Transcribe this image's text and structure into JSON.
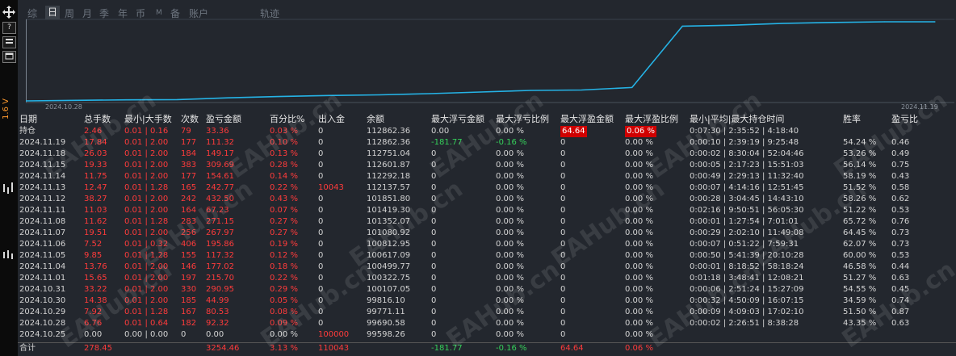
{
  "tabs": [
    "综",
    "日",
    "周",
    "月",
    "季",
    "年",
    "币",
    "M",
    "备",
    "账户",
    "轨迹"
  ],
  "active_tab": "日",
  "left_toolbar": {
    "icons": [
      "move-icon",
      "help-icon",
      "layout-icon",
      "window-icon"
    ],
    "help_glyph": "?",
    "vertical_text": "1.6 V"
  },
  "chart_data": {
    "type": "line",
    "x_start_label": "2024.10.28",
    "x_end_label": "2024.11.19",
    "color": "#25b3e6",
    "x": [
      "2024.10.25",
      "2024.10.28",
      "2024.10.29",
      "2024.10.30",
      "2024.10.31",
      "2024.11.01",
      "2024.11.04",
      "2024.11.05",
      "2024.11.06",
      "2024.11.07",
      "2024.11.08",
      "2024.11.11",
      "2024.11.12",
      "2024.11.13",
      "2024.11.14",
      "2024.11.15",
      "2024.11.18",
      "2024.11.19",
      "持仓"
    ],
    "y": [
      99598.26,
      99690.58,
      99771.11,
      99816.1,
      100107.05,
      100322.75,
      100499.77,
      100617.09,
      100812.95,
      101080.92,
      101352.07,
      101419.3,
      101851.8,
      112137.57,
      112292.18,
      112601.87,
      112751.04,
      112862.36,
      112862.36
    ]
  },
  "table": {
    "headers": [
      "日期",
      "总手数",
      "最小|大手数",
      "次数",
      "盈亏金额",
      "百分比%",
      "出入金",
      "余额",
      "最大浮亏金额",
      "最大浮亏比例",
      "最大浮盈金额",
      "最大浮盈比例",
      "最小|平均|最大持仓时间",
      "胜率",
      "盈亏比"
    ],
    "rows": [
      [
        "持仓",
        "2.46",
        "0.01 | 0.16",
        "79",
        "33.36",
        "0.03 %",
        "0",
        "112862.36",
        "0.00",
        "0.00 %",
        "64.64",
        "0.06 %",
        "0:07:30 | 2:35:52 | 4:18:40",
        "",
        ""
      ],
      [
        "2024.11.19",
        "17.84",
        "0.01 | 2.00",
        "177",
        "111.32",
        "0.10 %",
        "0",
        "112862.36",
        "-181.77",
        "-0.16 %",
        "0",
        "0.00 %",
        "0:00:10 | 2:39:19 | 9:25:48",
        "54.24 %",
        "0.46"
      ],
      [
        "2024.11.18",
        "26.03",
        "0.01 | 2.00",
        "184",
        "149.17",
        "0.13 %",
        "0",
        "112751.04",
        "0",
        "0.00 %",
        "0",
        "0.00 %",
        "0:00:02 | 8:30:04 | 52:04:46",
        "53.26 %",
        "0.49"
      ],
      [
        "2024.11.15",
        "19.33",
        "0.01 | 2.00",
        "383",
        "309.69",
        "0.28 %",
        "0",
        "112601.87",
        "0",
        "0.00 %",
        "0",
        "0.00 %",
        "0:00:05 | 2:17:23 | 15:51:03",
        "56.14 %",
        "0.75"
      ],
      [
        "2024.11.14",
        "11.75",
        "0.01 | 2.00",
        "177",
        "154.61",
        "0.14 %",
        "0",
        "112292.18",
        "0",
        "0.00 %",
        "0",
        "0.00 %",
        "0:00:49 | 2:29:13 | 11:32:40",
        "58.19 %",
        "0.43"
      ],
      [
        "2024.11.13",
        "12.47",
        "0.01 | 1.28",
        "165",
        "242.77",
        "0.22 %",
        "10043",
        "112137.57",
        "0",
        "0.00 %",
        "0",
        "0.00 %",
        "0:00:07 | 4:14:16 | 12:51:45",
        "51.52 %",
        "0.58"
      ],
      [
        "2024.11.12",
        "38.27",
        "0.01 | 2.00",
        "242",
        "432.50",
        "0.43 %",
        "0",
        "101851.80",
        "0",
        "0.00 %",
        "0",
        "0.00 %",
        "0:00:28 | 3:04:45 | 14:43:10",
        "58.26 %",
        "0.62"
      ],
      [
        "2024.11.11",
        "11.03",
        "0.01 | 2.00",
        "164",
        "67.23",
        "0.07 %",
        "0",
        "101419.30",
        "0",
        "0.00 %",
        "0",
        "0.00 %",
        "0:02:16 | 9:50:51 | 56:05:30",
        "51.22 %",
        "0.53"
      ],
      [
        "2024.11.08",
        "11.62",
        "0.01 | 1.28",
        "283",
        "271.15",
        "0.27 %",
        "0",
        "101352.07",
        "0",
        "0.00 %",
        "0",
        "0.00 %",
        "0:00:01 | 1:27:54 | 7:01:01",
        "65.72 %",
        "0.76"
      ],
      [
        "2024.11.07",
        "19.51",
        "0.01 | 2.00",
        "256",
        "267.97",
        "0.27 %",
        "0",
        "101080.92",
        "0",
        "0.00 %",
        "0",
        "0.00 %",
        "0:00:29 | 2:02:10 | 11:49:08",
        "64.45 %",
        "0.73"
      ],
      [
        "2024.11.06",
        "7.52",
        "0.01 | 0.32",
        "406",
        "195.86",
        "0.19 %",
        "0",
        "100812.95",
        "0",
        "0.00 %",
        "0",
        "0.00 %",
        "0:00:07 | 0:51:22 | 7:59:31",
        "62.07 %",
        "0.73"
      ],
      [
        "2024.11.05",
        "9.85",
        "0.01 | 1.28",
        "155",
        "117.32",
        "0.12 %",
        "0",
        "100617.09",
        "0",
        "0.00 %",
        "0",
        "0.00 %",
        "0:00:50 | 5:41:39 | 20:10:28",
        "60.00 %",
        "0.53"
      ],
      [
        "2024.11.04",
        "13.76",
        "0.01 | 2.00",
        "146",
        "177.02",
        "0.18 %",
        "0",
        "100499.77",
        "0",
        "0.00 %",
        "0",
        "0.00 %",
        "0:00:01 | 8:18:52 | 58:18:24",
        "46.58 %",
        "0.44"
      ],
      [
        "2024.11.01",
        "15.65",
        "0.01 | 2.00",
        "197",
        "215.70",
        "0.22 %",
        "0",
        "100322.75",
        "0",
        "0.00 %",
        "0",
        "0.00 %",
        "0:01:18 | 3:48:41 | 12:08:21",
        "51.27 %",
        "0.63"
      ],
      [
        "2024.10.31",
        "33.22",
        "0.01 | 2.00",
        "330",
        "290.95",
        "0.29 %",
        "0",
        "100107.05",
        "0",
        "0.00 %",
        "0",
        "0.00 %",
        "0:00:06 | 2:51:24 | 15:27:09",
        "54.55 %",
        "0.45"
      ],
      [
        "2024.10.30",
        "14.38",
        "0.01 | 2.00",
        "185",
        "44.99",
        "0.05 %",
        "0",
        "99816.10",
        "0",
        "0.00 %",
        "0",
        "0.00 %",
        "0:00:32 | 4:50:09 | 16:07:15",
        "34.59 %",
        "0.74"
      ],
      [
        "2024.10.29",
        "7.92",
        "0.01 | 1.28",
        "167",
        "80.53",
        "0.08 %",
        "0",
        "99771.11",
        "0",
        "0.00 %",
        "0",
        "0.00 %",
        "0:00:09 | 4:09:03 | 17:02:10",
        "51.50 %",
        "0.87"
      ],
      [
        "2024.10.28",
        "6.76",
        "0.01 | 0.64",
        "182",
        "92.32",
        "0.09 %",
        "0",
        "99690.58",
        "0",
        "0.00 %",
        "0",
        "0.00 %",
        "0:00:02 | 2:26:51 | 8:38:28",
        "43.35 %",
        "0.63"
      ],
      [
        "2024.10.25",
        "0.00",
        "0.00 | 0.00",
        "0",
        "0.00",
        "0.00 %",
        "100000",
        "99598.26",
        "0",
        "0.00 %",
        "0",
        "0.00 %",
        "",
        "",
        ""
      ]
    ],
    "total": [
      "合计",
      "278.45",
      "",
      "",
      "3254.46",
      "3.13 %",
      "110043",
      "",
      "-181.77",
      "-0.16 %",
      "64.64",
      "0.06 %",
      "",
      "",
      ""
    ]
  },
  "watermark": "EAHub.cn",
  "colors": {
    "panel_bg": "#23272e",
    "loss_red": "#ff3b3b",
    "gain_green": "#35d05a",
    "highlight_red": "#d00000",
    "curve_blue": "#25b3e6",
    "vertical_text_orange": "#ff9a2e"
  }
}
